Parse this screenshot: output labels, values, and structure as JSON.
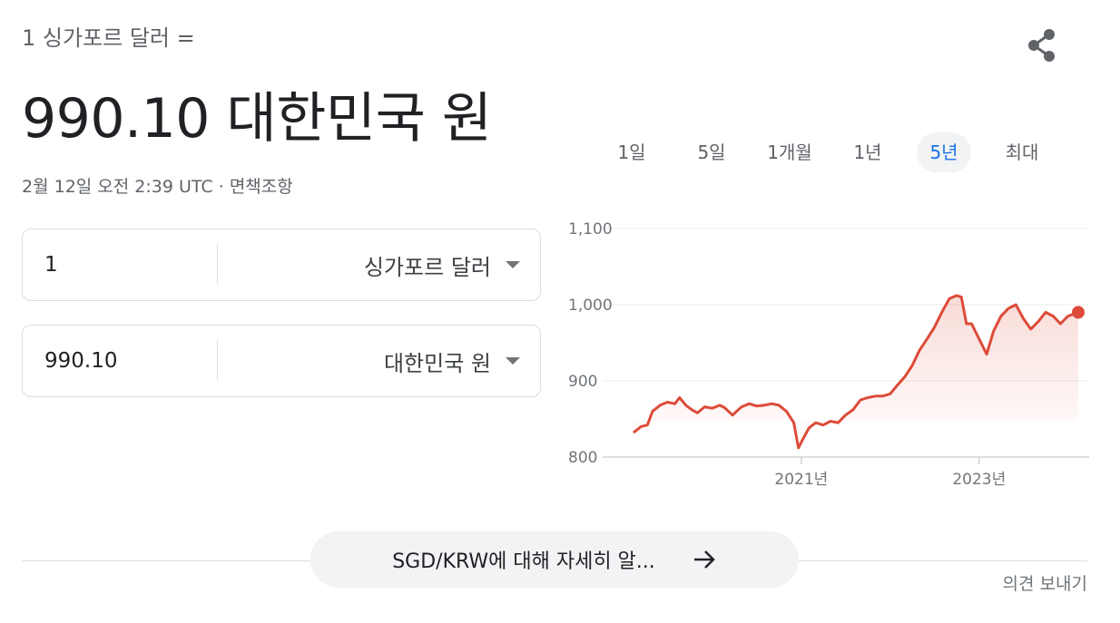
{
  "header": {
    "from_text": "1 싱가포르 달러 =",
    "result_text": "990.10 대한민국 원",
    "timestamp": "2월 12일 오전 2:39 UTC",
    "timestamp_sep": " · ",
    "disclaimer": "면책조항",
    "share_icon": "share-icon"
  },
  "converter": {
    "from_amount": "1",
    "from_currency": "싱가포르 달러",
    "to_amount": "990.10",
    "to_currency": "대한민국 원"
  },
  "ranges": [
    "1일",
    "5일",
    "1개월",
    "1년",
    "5년",
    "최대"
  ],
  "active_range": "5년",
  "footer": {
    "more_label": "SGD/KRW에 대해 자세히 알...",
    "more_icon": "arrow-right-icon",
    "feedback": "의견 보내기"
  },
  "colors": {
    "line": "#dd4b39",
    "active_tab": "#1a73e8",
    "gridline": "#ebebeb"
  },
  "chart_data": {
    "type": "area",
    "ylim": [
      800,
      1100
    ],
    "yticks": [
      800,
      900,
      1000,
      1100
    ],
    "ytick_labels": [
      "800",
      "900",
      "1,000",
      "1,100"
    ],
    "xtick_labels": [
      {
        "x": "2021-01-01",
        "label": "2021년"
      },
      {
        "x": "2023-01-01",
        "label": "2023년"
      }
    ],
    "xlim": [
      "2019-02-12",
      "2024-02-12"
    ],
    "series": [
      {
        "x": [
          "2019-02-12",
          "2019-03-15",
          "2019-04-10",
          "2019-05-01",
          "2019-06-01",
          "2019-07-01",
          "2019-08-01",
          "2019-08-20",
          "2019-09-15",
          "2019-10-10",
          "2019-11-01",
          "2019-12-01",
          "2020-01-01",
          "2020-02-01",
          "2020-02-20",
          "2020-03-15",
          "2020-03-25",
          "2020-04-10",
          "2020-05-01",
          "2020-06-01",
          "2020-07-01",
          "2020-08-01",
          "2020-09-01",
          "2020-10-01",
          "2020-11-01",
          "2020-12-01",
          "2020-12-20",
          "2021-01-10",
          "2021-02-01",
          "2021-03-01",
          "2021-04-01",
          "2021-05-01",
          "2021-06-01",
          "2021-07-01",
          "2021-08-01",
          "2021-09-01",
          "2021-10-01",
          "2021-11-01",
          "2021-12-01",
          "2022-01-01",
          "2022-02-01",
          "2022-03-01",
          "2022-04-01",
          "2022-05-01",
          "2022-06-01",
          "2022-07-01",
          "2022-08-01",
          "2022-09-01",
          "2022-10-01",
          "2022-10-20",
          "2022-11-10",
          "2022-12-01",
          "2023-01-01",
          "2023-02-01",
          "2023-03-01",
          "2023-04-01",
          "2023-05-01",
          "2023-06-01",
          "2023-07-01",
          "2023-08-01",
          "2023-09-01",
          "2023-10-01",
          "2023-11-01",
          "2023-12-01",
          "2024-01-01",
          "2024-02-12"
        ],
        "y": [
          832,
          840,
          842,
          860,
          868,
          872,
          870,
          878,
          868,
          862,
          858,
          866,
          864,
          868,
          865,
          858,
          855,
          860,
          866,
          870,
          867,
          868,
          870,
          868,
          860,
          845,
          812,
          825,
          838,
          845,
          842,
          847,
          845,
          855,
          862,
          875,
          878,
          880,
          880,
          883,
          895,
          905,
          920,
          940,
          955,
          970,
          990,
          1008,
          1012,
          1010,
          975,
          975,
          955,
          935,
          965,
          985,
          995,
          1000,
          982,
          968,
          978,
          990,
          985,
          975,
          985,
          990
        ]
      }
    ]
  }
}
